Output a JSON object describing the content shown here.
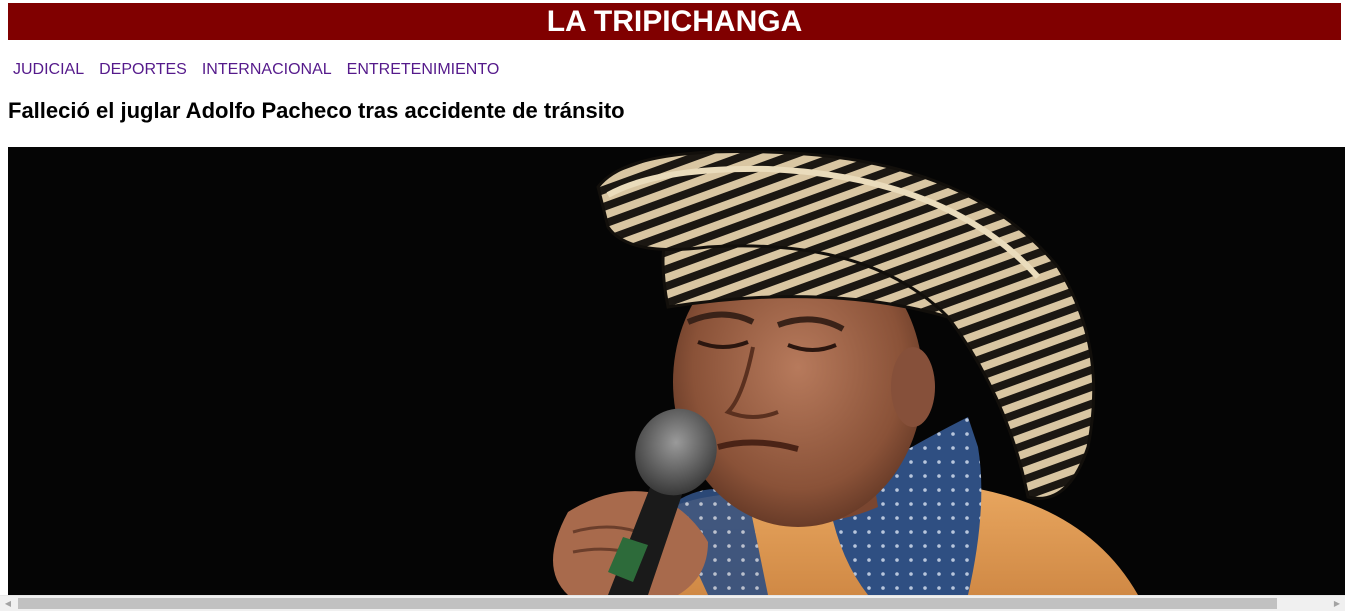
{
  "site": {
    "title": "LA TRIPICHANGA",
    "brand_color": "#800000"
  },
  "nav": {
    "items": [
      {
        "label": "JUDICIAL"
      },
      {
        "label": "DEPORTES"
      },
      {
        "label": "INTERNACIONAL"
      },
      {
        "label": "ENTRETENIMIENTO"
      }
    ],
    "link_color": "#551a8b"
  },
  "article": {
    "headline": "Falleció el juglar Adolfo Pacheco tras accidente de tránsito",
    "image": {
      "subject": "elderly man in a sombrero vueltiao singing into a microphone",
      "background_color": "#050505"
    }
  },
  "scrollbar": {
    "left_icon": "triangle-left-icon",
    "right_icon": "triangle-right-icon"
  }
}
